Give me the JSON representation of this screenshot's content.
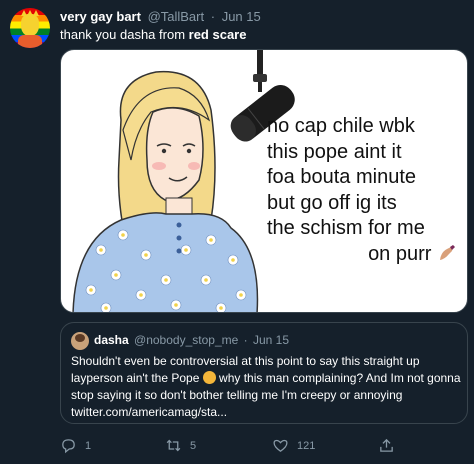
{
  "tweet": {
    "display_name": "very gay bart",
    "handle": "@TallBart",
    "separator": "·",
    "date": "Jun 15",
    "text_prefix": "thank you dasha from ",
    "text_bold": "red scare"
  },
  "media": {
    "meme_lines": [
      "no cap chile wbk",
      "this pope aint it",
      "foa bouta minute",
      "but go off ig its",
      "the schism for me",
      "on purr"
    ]
  },
  "quoted_tweet": {
    "display_name": "dasha",
    "handle": "@nobody_stop_me",
    "separator": "·",
    "date": "Jun 15",
    "text_part1": "Shouldn't even be controversial at this point to say this straight up layperson ain't the Pope ",
    "text_part2": " why this man complaining? And Im not gonna stop saying it so don't bother telling me I'm creepy or annoying",
    "link": "twitter.com/americamag/sta..."
  },
  "actions": {
    "reply_count": "1",
    "retweet_count": "5",
    "like_count": "121"
  },
  "colors": {
    "background": "#15202b",
    "secondary_text": "#8899a6",
    "border": "#38444d"
  }
}
